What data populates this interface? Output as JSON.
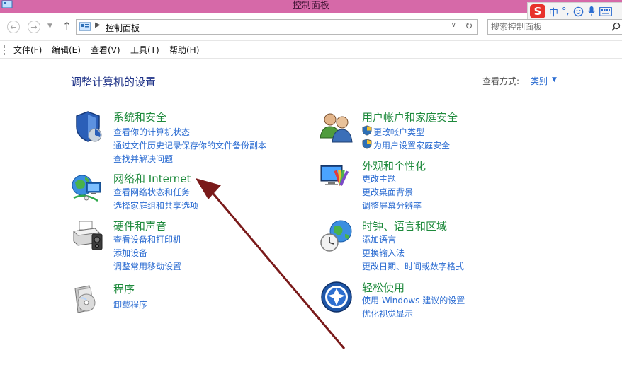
{
  "window": {
    "title": "控制面板"
  },
  "ime": {
    "lang": "中",
    "punct": "°,"
  },
  "address": {
    "path": "控制面板",
    "search_placeholder": "搜索控制面板"
  },
  "menu": [
    "文件(F)",
    "编辑(E)",
    "查看(V)",
    "工具(T)",
    "帮助(H)"
  ],
  "main": {
    "title": "调整计算机的设置",
    "view_by_label": "查看方式:",
    "view_by_value": "类别"
  },
  "categories": [
    {
      "title": "系统和安全",
      "links": [
        "查看你的计算机状态",
        "通过文件历史记录保存你的文件备份副本",
        "查找并解决问题"
      ]
    },
    {
      "title": "网络和 Internet",
      "links": [
        "查看网络状态和任务",
        "选择家庭组和共享选项"
      ]
    },
    {
      "title": "硬件和声音",
      "links": [
        "查看设备和打印机",
        "添加设备",
        "调整常用移动设置"
      ]
    },
    {
      "title": "程序",
      "links": [
        "卸载程序"
      ]
    },
    {
      "title": "用户帐户和家庭安全",
      "links": [
        "更改帐户类型",
        "为用户设置家庭安全"
      ]
    },
    {
      "title": "外观和个性化",
      "links": [
        "更改主题",
        "更改桌面背景",
        "调整屏幕分辨率"
      ]
    },
    {
      "title": "时钟、语言和区域",
      "links": [
        "添加语言",
        "更换输入法",
        "更改日期、时间或数字格式"
      ]
    },
    {
      "title": "轻松使用",
      "links": [
        "使用 Windows 建议的设置",
        "优化视觉显示"
      ]
    }
  ],
  "colors": {
    "titlebar": "#d669a8",
    "category_title": "#1e8a3c",
    "link": "#2a6bd1",
    "heading": "#1e3287",
    "annotation_arrow": "#7a1a1a"
  }
}
